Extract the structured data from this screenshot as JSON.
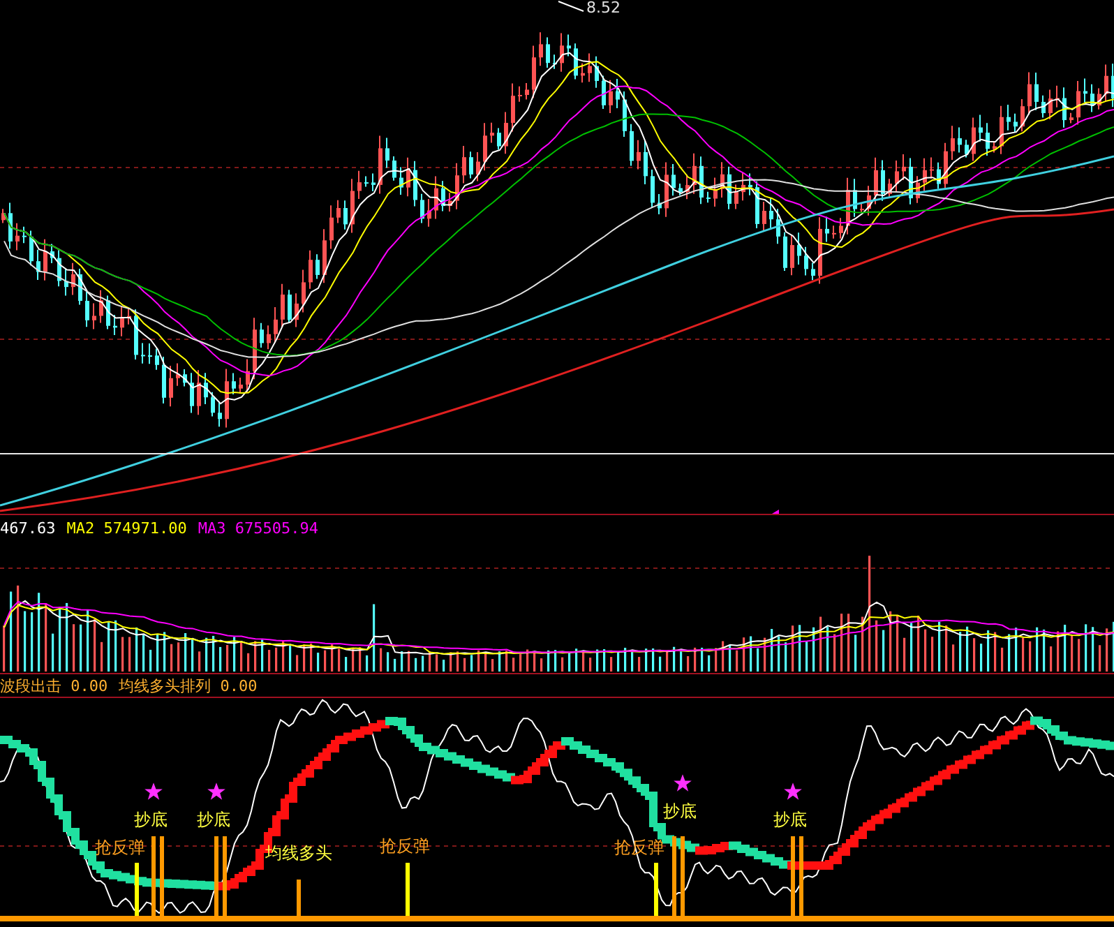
{
  "price_panel": {
    "high_label": "8.52"
  },
  "volume_panel": {
    "legend": [
      {
        "value": "467.63",
        "color": "#ffffff"
      },
      {
        "name": "MA2",
        "value": "574971.00",
        "color": "#ffff00"
      },
      {
        "name": "MA3",
        "value": "675505.94",
        "color": "#ff00ff"
      }
    ]
  },
  "indicator_panel": {
    "legend": [
      {
        "name": "波段出击",
        "value": "0.00"
      },
      {
        "name": "均线多头排列",
        "value": "0.00"
      }
    ],
    "signals": [
      {
        "kind": "bottom",
        "text": "抄底"
      },
      {
        "kind": "bottom",
        "text": "抄底"
      },
      {
        "kind": "bottom",
        "text": "抄底"
      },
      {
        "kind": "bottom",
        "text": "抄底"
      },
      {
        "kind": "rebound",
        "text": "抢反弹"
      },
      {
        "kind": "trend",
        "text": "均线多头"
      },
      {
        "kind": "rebound",
        "text": "抢反弹"
      },
      {
        "kind": "rebound",
        "text": "抢反弹"
      }
    ]
  }
}
